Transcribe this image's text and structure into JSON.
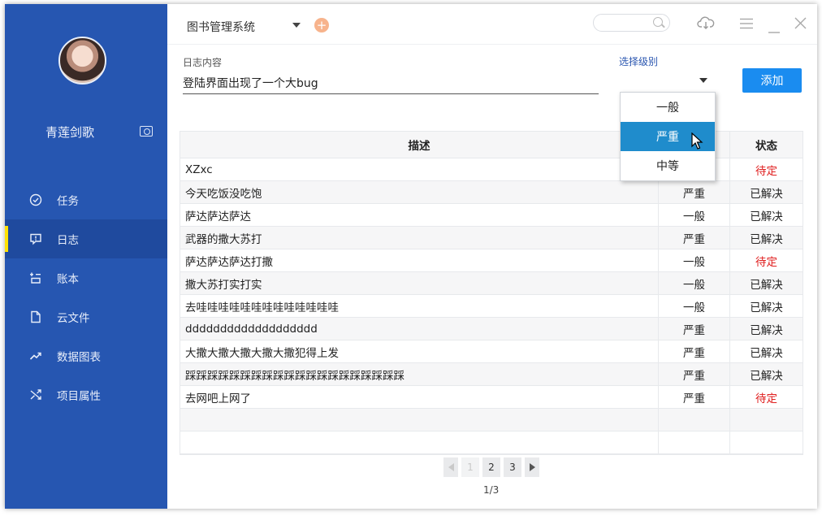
{
  "sidebar": {
    "username": "青莲剑歌",
    "items": [
      {
        "label": "任务",
        "icon": "check-circle-icon",
        "active": false
      },
      {
        "label": "日志",
        "icon": "message-alert-icon",
        "active": true
      },
      {
        "label": "账本",
        "icon": "ledger-icon",
        "active": false
      },
      {
        "label": "云文件",
        "icon": "file-icon",
        "active": false
      },
      {
        "label": "数据图表",
        "icon": "trend-chart-icon",
        "active": false
      },
      {
        "label": "项目属性",
        "icon": "shuffle-icon",
        "active": false
      }
    ],
    "accent": "#2656b1",
    "active_marker": "#ffe100"
  },
  "header": {
    "title": "图书管理系统",
    "icons": [
      "cloud-download-icon",
      "menu-icon",
      "minimize-icon",
      "close-icon"
    ]
  },
  "form": {
    "content_label": "日志内容",
    "content_value": "登陆界面出现了一个大bug",
    "level_label": "选择级别",
    "add_label": "添加",
    "add_color": "#1a8cf0"
  },
  "dropdown": {
    "options": [
      "一般",
      "严重",
      "中等"
    ],
    "selected_index": 1
  },
  "table": {
    "headers": [
      "描述",
      "",
      "状态"
    ],
    "rows": [
      {
        "desc": "XZxc",
        "level": "",
        "status": "待定"
      },
      {
        "desc": "今天吃饭没吃饱",
        "level": "严重",
        "status": "已解决"
      },
      {
        "desc": "萨达萨达萨达",
        "level": "一般",
        "status": "已解决"
      },
      {
        "desc": "武器的撒大苏打",
        "level": "严重",
        "status": "已解决"
      },
      {
        "desc": "萨达萨达萨达打撒",
        "level": "一般",
        "status": "待定"
      },
      {
        "desc": "撒大苏打实打实",
        "level": "一般",
        "status": "已解决"
      },
      {
        "desc": "去哇哇哇哇哇哇哇哇哇哇哇哇哇",
        "level": "一般",
        "status": "已解决"
      },
      {
        "desc": "ddddddddddddddddddd",
        "level": "严重",
        "status": "已解决"
      },
      {
        "desc": "大撒大撒大撒大撒大撒犯得上发",
        "level": "严重",
        "status": "已解决"
      },
      {
        "desc": "踩踩踩踩踩踩踩踩踩踩踩踩踩踩踩踩踩踩踩踩",
        "level": "严重",
        "status": "已解决"
      },
      {
        "desc": "去网吧上网了",
        "level": "严重",
        "status": "待定"
      },
      {
        "desc": "",
        "level": "",
        "status": ""
      },
      {
        "desc": "",
        "level": "",
        "status": ""
      }
    ],
    "pending_color": "#e02020"
  },
  "pagination": {
    "pages": [
      "1",
      "2",
      "3"
    ],
    "current": "1",
    "summary": "1/3"
  }
}
